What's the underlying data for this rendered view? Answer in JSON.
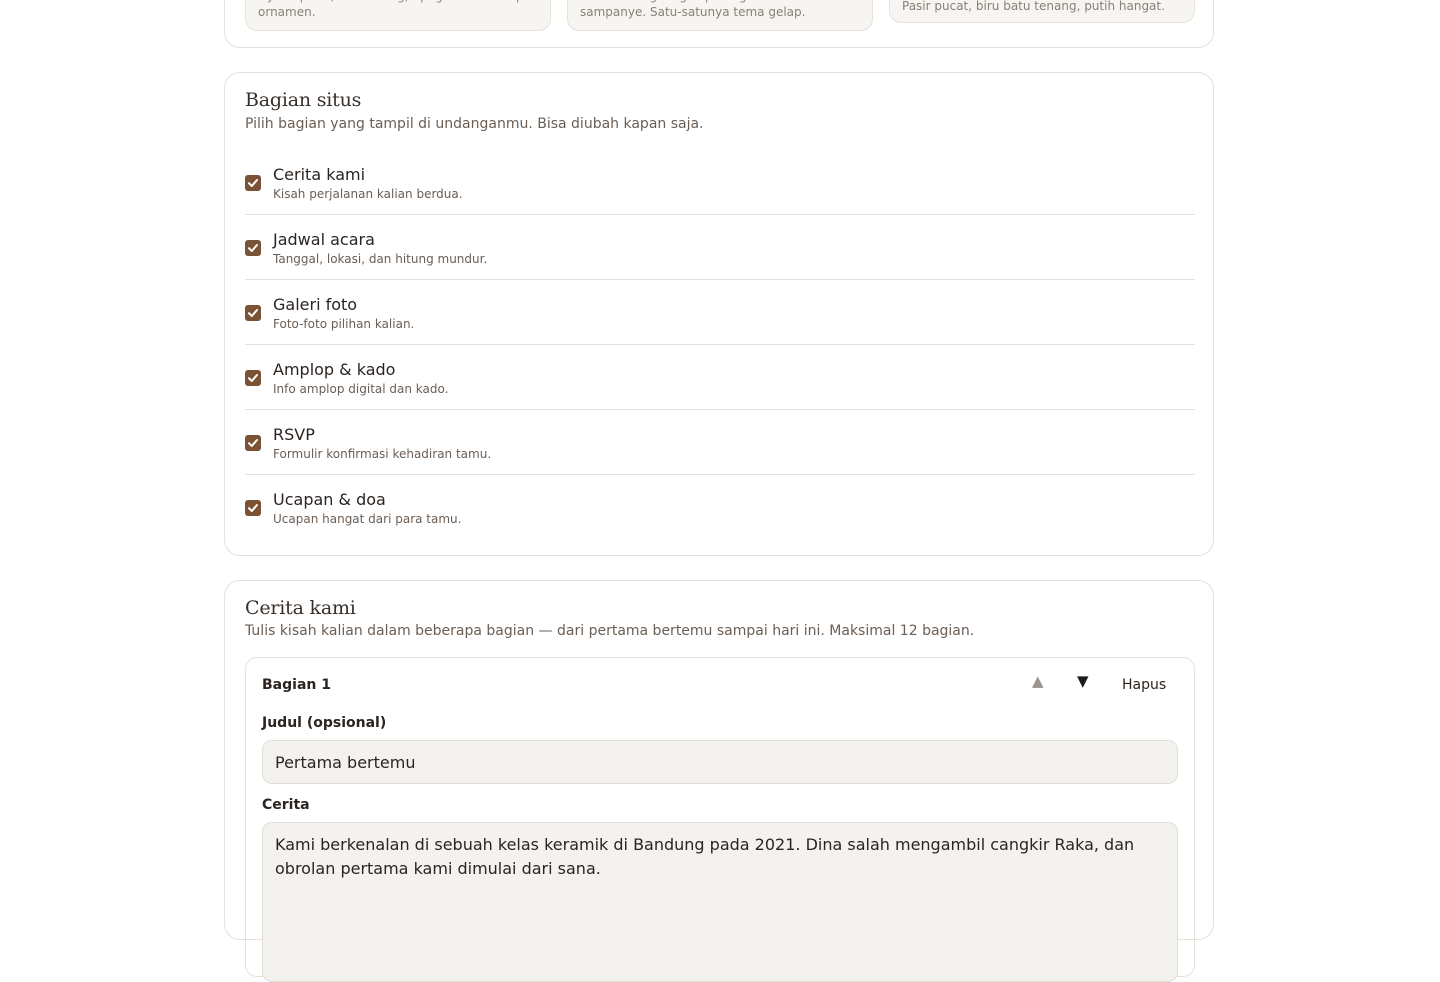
{
  "themes": [
    {
      "desc": "Nyaris putih, tinta arang, tipografi satu tanpa ornamen."
    },
    {
      "desc": "Latar aubergine gelap dengan aksen sampanye. Satu-satunya tema gelap."
    },
    {
      "desc": "Pasir pucat, biru batu tenang, putih hangat."
    }
  ],
  "sections": {
    "title": "Bagian situs",
    "subtitle": "Pilih bagian yang tampil di undanganmu. Bisa diubah kapan saja.",
    "items": [
      {
        "label": "Cerita kami",
        "desc": "Kisah perjalanan kalian berdua.",
        "checked": true
      },
      {
        "label": "Jadwal acara",
        "desc": "Tanggal, lokasi, dan hitung mundur.",
        "checked": true
      },
      {
        "label": "Galeri foto",
        "desc": "Foto-foto pilihan kalian.",
        "checked": true
      },
      {
        "label": "Amplop & kado",
        "desc": "Info amplop digital dan kado.",
        "checked": true
      },
      {
        "label": "RSVP",
        "desc": "Formulir konfirmasi kehadiran tamu.",
        "checked": true
      },
      {
        "label": "Ucapan & doa",
        "desc": "Ucapan hangat dari para tamu.",
        "checked": true
      }
    ]
  },
  "story": {
    "title": "Cerita kami",
    "subtitle": "Tulis kisah kalian dalam beberapa bagian — dari pertama bertemu sampai hari ini. Maksimal 12 bagian.",
    "part": {
      "label": "Bagian 1",
      "up_icon": "▲",
      "down_icon": "▼",
      "delete_label": "Hapus",
      "title_label": "Judul (opsional)",
      "title_value": "Pertama bertemu",
      "story_label": "Cerita",
      "story_value": "Kami berkenalan di sebuah kelas keramik di Bandung pada 2021. Dina salah mengambil cangkir Raka, dan obrolan pertama kami dimulai dari sana."
    }
  },
  "colors": {
    "accent": "#7a5236",
    "border": "#e6e0d8",
    "field_bg": "#f4f2ee"
  }
}
